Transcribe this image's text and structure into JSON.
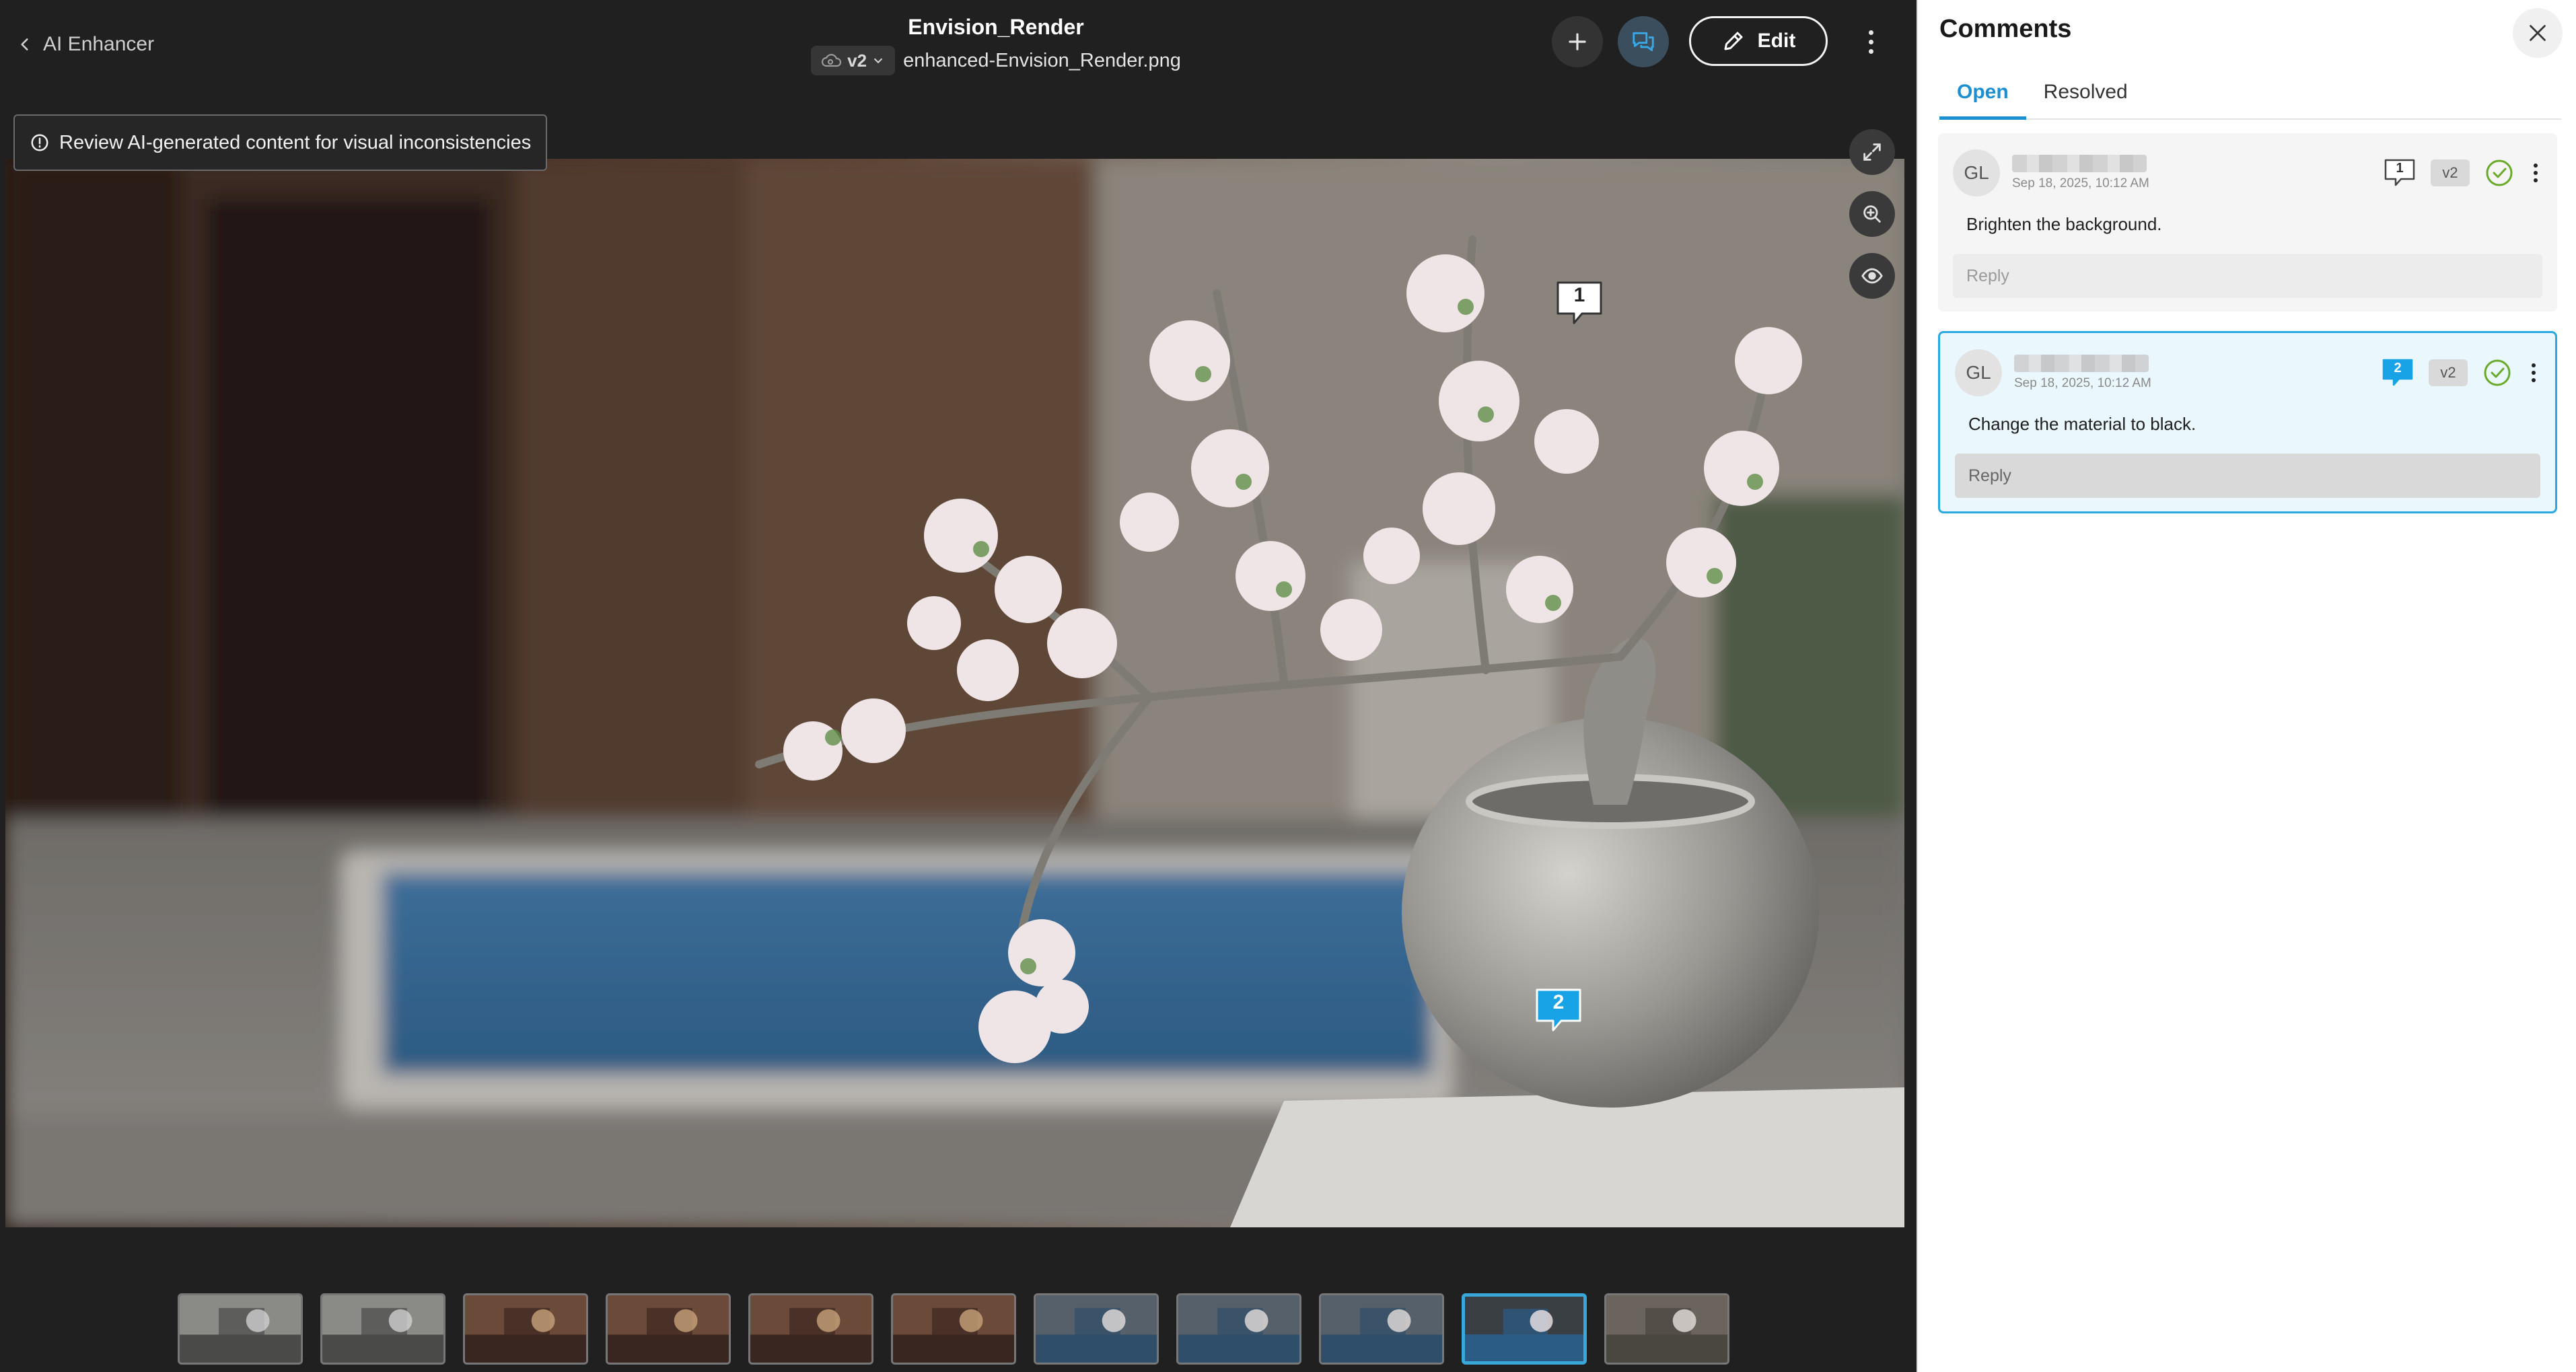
{
  "header": {
    "back_label": "AI Enhancer",
    "title": "Envision_Render",
    "version": "v2",
    "filename": "enhanced-Envision_Render.png",
    "edit_label": "Edit"
  },
  "notice": {
    "text": "Review AI-generated content for visual inconsistencies"
  },
  "pins": [
    {
      "number": "1"
    },
    {
      "number": "2"
    }
  ],
  "filmstrip": {
    "count": 11,
    "active_index": 9
  },
  "panel": {
    "title": "Comments",
    "tabs": [
      {
        "label": "Open",
        "active": true
      },
      {
        "label": "Resolved",
        "active": false
      }
    ],
    "comments": [
      {
        "initials": "GL",
        "timestamp": "Sep 18, 2025, 10:12 AM",
        "pin_number": "1",
        "version": "v2",
        "text": "Brighten the background.",
        "reply_placeholder": "Reply",
        "selected": false
      },
      {
        "initials": "GL",
        "timestamp": "Sep 18, 2025, 10:12 AM",
        "pin_number": "2",
        "version": "v2",
        "text": "Change the material to black.",
        "reply_placeholder": "Reply",
        "selected": true
      }
    ]
  },
  "colors": {
    "accent": "#1c8fd0",
    "selected_border": "#2aa9e0",
    "resolve_green": "#6aaa2a",
    "pin_blue": "#17a3e6"
  },
  "icons": [
    "chevron-left-icon",
    "version-cloud-icon",
    "chevron-down-icon",
    "plus-icon",
    "chat-icon",
    "pencil-icon",
    "more-vertical-icon",
    "info-icon",
    "expand-icon",
    "zoom-in-icon",
    "eye-icon",
    "close-icon",
    "comment-count-icon",
    "check-circle-icon"
  ]
}
